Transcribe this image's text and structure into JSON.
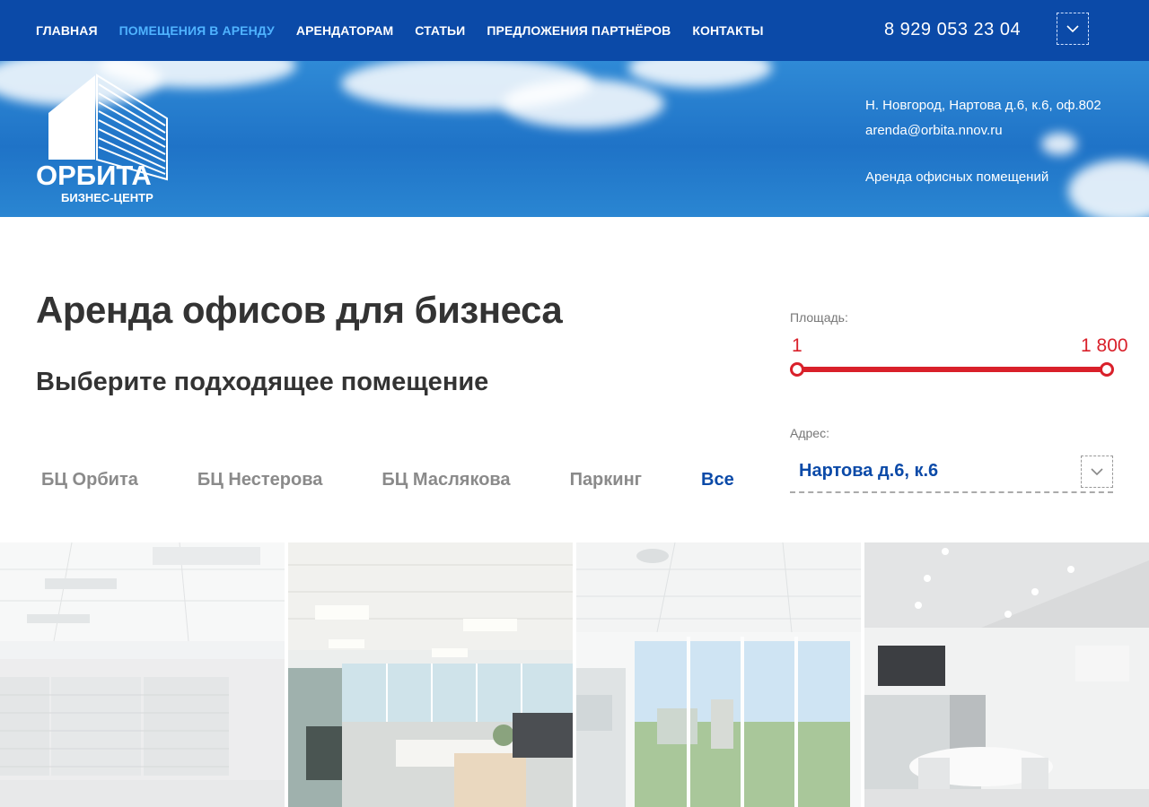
{
  "nav": {
    "items": [
      {
        "label": "ГЛАВНАЯ",
        "active": false
      },
      {
        "label": "ПОМЕЩЕНИЯ В АРЕНДУ",
        "active": true
      },
      {
        "label": "АРЕНДАТОРАМ",
        "active": false
      },
      {
        "label": "СТАТЬИ",
        "active": false
      },
      {
        "label": "ПРЕДЛОЖЕНИЯ ПАРТНЁРОВ",
        "active": false
      },
      {
        "label": "КОНТАКТЫ",
        "active": false
      }
    ],
    "phone": "8 929 053 23 04",
    "menu_icon": "chevron-down-icon"
  },
  "banner": {
    "logo_title": "ОРБИТА",
    "logo_subtitle": "БИЗНЕС-ЦЕНТР",
    "address": "Н. Новгород, Нартова д.6, к.6, оф.802",
    "email": "arenda@orbita.nnov.ru",
    "tagline": "Аренда офисных помещений"
  },
  "main": {
    "title": "Аренда офисов для бизнеса",
    "subtitle": "Выберите подходящее помещение",
    "tabs": [
      {
        "label": "БЦ Орбита",
        "active": false
      },
      {
        "label": "БЦ Нестерова",
        "active": false
      },
      {
        "label": "БЦ Маслякова",
        "active": false
      },
      {
        "label": "Паркинг",
        "active": false
      },
      {
        "label": "Все",
        "active": true
      }
    ]
  },
  "filters": {
    "area_label": "Площадь:",
    "area_min": "1",
    "area_max": "1 800",
    "address_label": "Адрес:",
    "address_value": "Нартова д.6, к.6"
  },
  "colors": {
    "brand": "#0b4aa8",
    "accent": "#d9202a",
    "active_nav": "#4fb3ff"
  }
}
